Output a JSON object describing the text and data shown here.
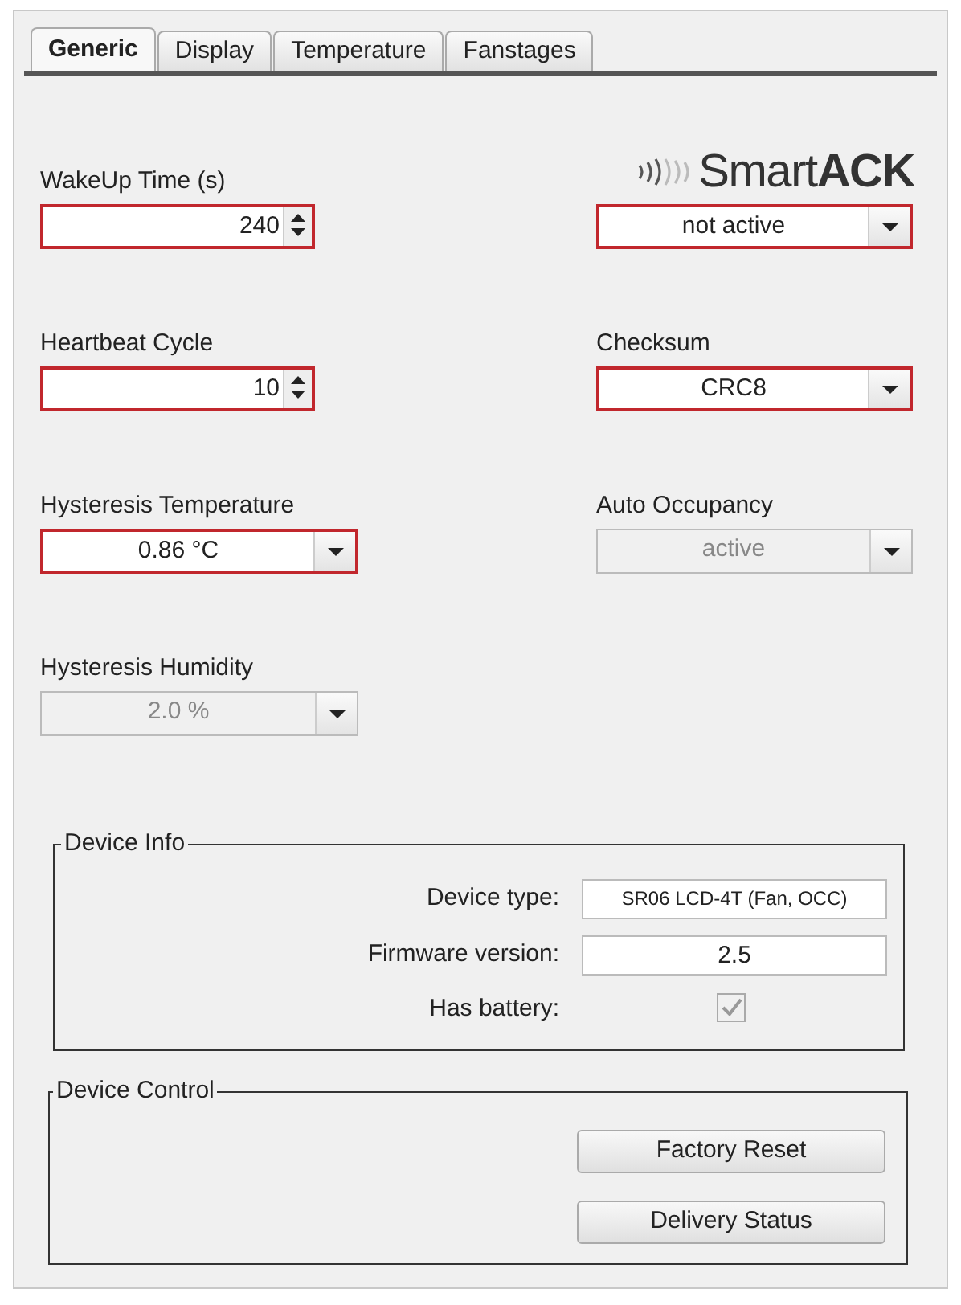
{
  "tabs": [
    {
      "label": "Generic",
      "selected": true
    },
    {
      "label": "Display",
      "selected": false
    },
    {
      "label": "Temperature",
      "selected": false
    },
    {
      "label": "Fanstages",
      "selected": false
    }
  ],
  "fields": [
    {
      "label": "WakeUp Time (s)",
      "kind": "spinner",
      "value": "240",
      "highlighted": true,
      "disabled": false
    },
    {
      "logo": "Smart**ACK**",
      "kind": "dropdown",
      "value": "not active",
      "highlighted": true,
      "disabled": false
    },
    {
      "label": "Heartbeat Cycle",
      "kind": "spinner",
      "value": "10",
      "highlighted": true,
      "disabled": false
    },
    {
      "label": "Checksum",
      "kind": "dropdown",
      "value": "CRC8",
      "highlighted": true,
      "disabled": false
    },
    {
      "label": "Hysteresis Temperature",
      "kind": "dropdown",
      "value": "0.86 °C",
      "highlighted": true,
      "disabled": false
    },
    {
      "label": "Auto Occupancy",
      "kind": "dropdown",
      "value": "active",
      "highlighted": false,
      "disabled": true
    },
    {
      "label": "Hysteresis Humidity",
      "kind": "dropdown",
      "value": "2.0 %",
      "highlighted": false,
      "disabled": true
    }
  ],
  "device_info": {
    "title": "Device Info",
    "rows": [
      {
        "label": "Device type:",
        "kind": "text",
        "value": "SR06 LCD-4T (Fan, OCC)"
      },
      {
        "label": "Firmware version:",
        "kind": "text",
        "value": "2.5"
      },
      {
        "label": "Has battery:",
        "kind": "checkbox",
        "checked": true,
        "disabled": true
      }
    ]
  },
  "device_control": {
    "title": "Device Control",
    "buttons": [
      "Factory Reset",
      "Delivery Status"
    ]
  }
}
